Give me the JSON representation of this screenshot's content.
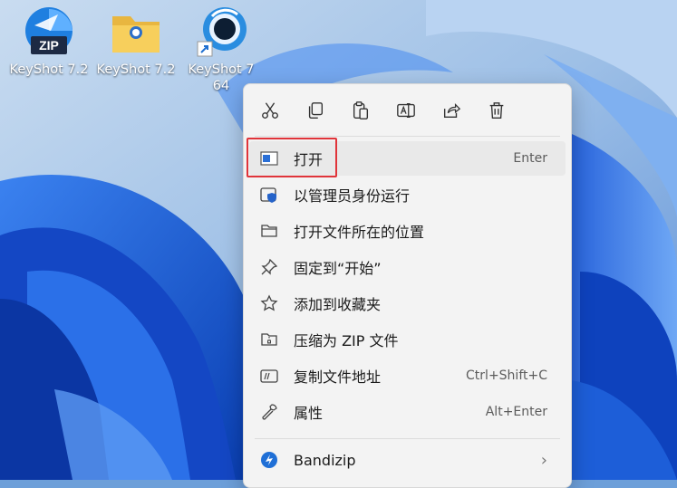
{
  "desktop": {
    "icons": [
      {
        "label": "KeyShot 7.2",
        "icon": "zip-archive-icon",
        "badge": "ZIP"
      },
      {
        "label": "KeyShot 7.2",
        "icon": "folder-icon"
      },
      {
        "label": "KeyShot 7\n64",
        "icon": "keyshot-shortcut-icon"
      }
    ]
  },
  "toolbar": {
    "actions": [
      {
        "icon": "cut-icon"
      },
      {
        "icon": "copy-icon"
      },
      {
        "icon": "paste-icon"
      },
      {
        "icon": "rename-icon"
      },
      {
        "icon": "share-icon"
      },
      {
        "icon": "delete-icon"
      }
    ]
  },
  "menu": {
    "items": [
      {
        "label": "打开",
        "shortcut": "Enter",
        "icon": "open-window-icon"
      },
      {
        "label": "以管理员身份运行",
        "shortcut": "",
        "icon": "shield-icon"
      },
      {
        "label": "打开文件所在的位置",
        "shortcut": "",
        "icon": "folder-outline-icon"
      },
      {
        "label": "固定到“开始”",
        "shortcut": "",
        "icon": "pin-icon"
      },
      {
        "label": "添加到收藏夹",
        "shortcut": "",
        "icon": "star-icon"
      },
      {
        "label": "压缩为 ZIP 文件",
        "shortcut": "",
        "icon": "zip-folder-icon"
      },
      {
        "label": "复制文件地址",
        "shortcut": "Ctrl+Shift+C",
        "icon": "copy-path-icon"
      },
      {
        "label": "属性",
        "shortcut": "Alt+Enter",
        "icon": "wrench-icon"
      },
      {
        "label": "Bandizip",
        "shortcut": "",
        "icon": "bandizip-icon",
        "submenu": "›"
      }
    ]
  },
  "colors": {
    "highlight_box": "#e0343a",
    "wallpaper_blue": "#1e5fd6"
  }
}
